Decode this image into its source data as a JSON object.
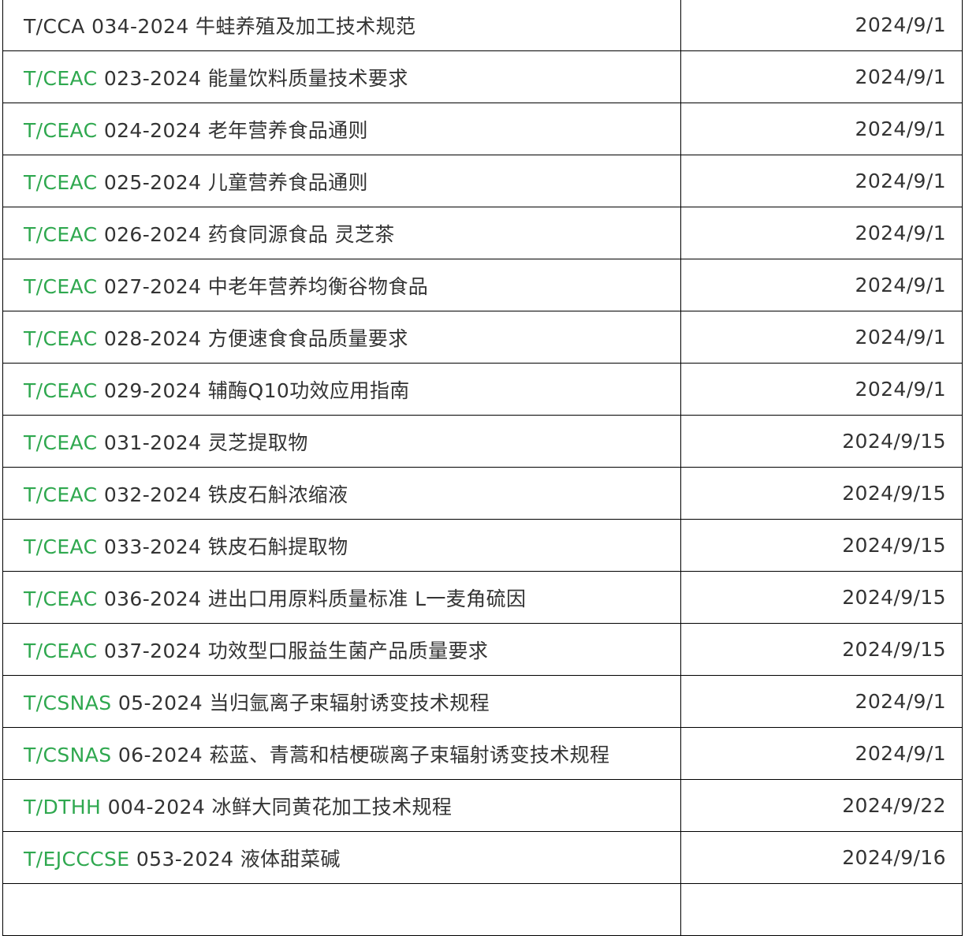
{
  "rows": [
    {
      "prefix": "T/CCA",
      "prefix_linked": false,
      "rest": " 034-2024 牛蛙养殖及加工技术规范",
      "date": "2024/9/1"
    },
    {
      "prefix": "T/CEAC",
      "prefix_linked": true,
      "rest": " 023-2024 能量饮料质量技术要求",
      "date": "2024/9/1"
    },
    {
      "prefix": "T/CEAC",
      "prefix_linked": true,
      "rest": " 024-2024 老年营养食品通则",
      "date": "2024/9/1"
    },
    {
      "prefix": "T/CEAC",
      "prefix_linked": true,
      "rest": " 025-2024 儿童营养食品通则",
      "date": "2024/9/1"
    },
    {
      "prefix": "T/CEAC",
      "prefix_linked": true,
      "rest": " 026-2024 药食同源食品 灵芝茶",
      "date": "2024/9/1"
    },
    {
      "prefix": "T/CEAC",
      "prefix_linked": true,
      "rest": " 027-2024 中老年营养均衡谷物食品",
      "date": "2024/9/1"
    },
    {
      "prefix": "T/CEAC",
      "prefix_linked": true,
      "rest": " 028-2024 方便速食食品质量要求",
      "date": "2024/9/1"
    },
    {
      "prefix": "T/CEAC",
      "prefix_linked": true,
      "rest": " 029-2024 辅酶Q10功效应用指南",
      "date": "2024/9/1"
    },
    {
      "prefix": "T/CEAC",
      "prefix_linked": true,
      "rest": " 031-2024 灵芝提取物",
      "date": "2024/9/15"
    },
    {
      "prefix": "T/CEAC",
      "prefix_linked": true,
      "rest": " 032-2024 铁皮石斛浓缩液",
      "date": "2024/9/15"
    },
    {
      "prefix": "T/CEAC",
      "prefix_linked": true,
      "rest": " 033-2024 铁皮石斛提取物",
      "date": "2024/9/15"
    },
    {
      "prefix": "T/CEAC",
      "prefix_linked": true,
      "rest": " 036-2024 进出口用原料质量标准 L一麦角硫因",
      "date": "2024/9/15"
    },
    {
      "prefix": "T/CEAC",
      "prefix_linked": true,
      "rest": " 037-2024 功效型口服益生菌产品质量要求",
      "date": "2024/9/15"
    },
    {
      "prefix": "T/CSNAS",
      "prefix_linked": true,
      "rest": " 05-2024 当归氩离子束辐射诱变技术规程",
      "date": "2024/9/1"
    },
    {
      "prefix": "T/CSNAS",
      "prefix_linked": true,
      "rest": " 06-2024 菘蓝、青蒿和桔梗碳离子束辐射诱变技术规程",
      "date": "2024/9/1"
    },
    {
      "prefix": "T/DTHH",
      "prefix_linked": true,
      "rest": " 004-2024 冰鲜大同黄花加工技术规程",
      "date": "2024/9/22"
    },
    {
      "prefix": "T/EJCCCSE",
      "prefix_linked": true,
      "rest": " 053-2024 液体甜菜碱",
      "date": "2024/9/16"
    },
    {
      "prefix": "",
      "prefix_linked": false,
      "rest": "",
      "date": ""
    }
  ]
}
